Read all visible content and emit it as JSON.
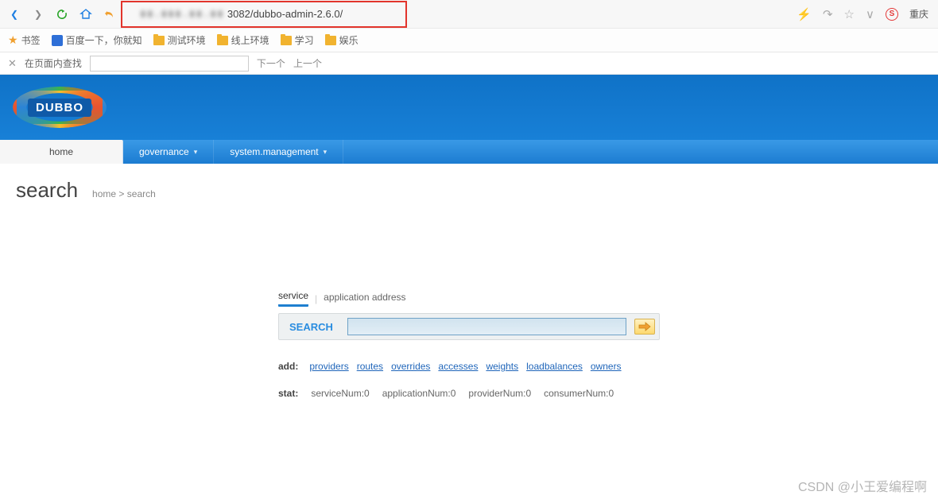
{
  "browser": {
    "url_obscured": "▮▮.▮▮▮.▮▮.▮▮",
    "url_tail": "3082/dubbo-admin-2.6.0/",
    "region": "重庆"
  },
  "bookmarks": {
    "label": "书签",
    "baidu": "百度一下，你就知",
    "items": [
      "测试环境",
      "线上环境",
      "学习",
      "娱乐"
    ]
  },
  "findbar": {
    "label": "在页面内查找",
    "next": "下一个",
    "prev": "上一个"
  },
  "logo_text": "DUBBO",
  "nav": {
    "home": "home",
    "governance": "governance",
    "sysmgmt": "system.management"
  },
  "page": {
    "title": "search",
    "breadcrumb_home": "home",
    "breadcrumb_sep": ">",
    "breadcrumb_current": "search"
  },
  "search": {
    "tab_service": "service",
    "tab_appaddr": "application address",
    "label": "SEARCH",
    "value": ""
  },
  "add": {
    "label": "add:",
    "links": [
      "providers",
      "routes",
      "overrides",
      "accesses",
      "weights",
      "loadbalances",
      "owners"
    ]
  },
  "stat": {
    "label": "stat:",
    "items": [
      "serviceNum:0",
      "applicationNum:0",
      "providerNum:0",
      "consumerNum:0"
    ]
  },
  "watermark": "CSDN @小王爱编程啊"
}
